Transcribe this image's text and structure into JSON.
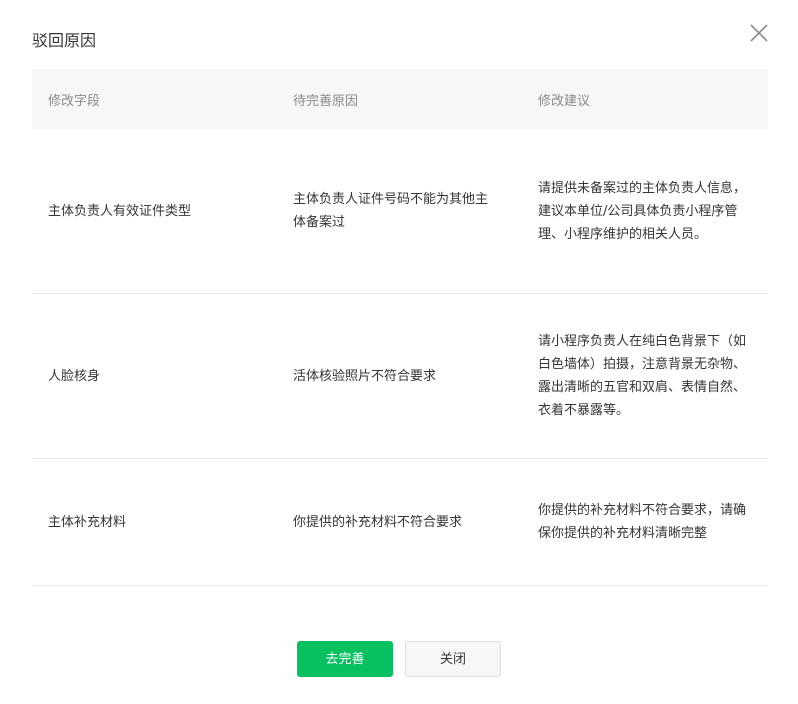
{
  "dialog": {
    "title": "驳回原因",
    "close_icon": "close-icon"
  },
  "table": {
    "headers": [
      "修改字段",
      "待完善原因",
      "修改建议"
    ],
    "rows": [
      {
        "field": "主体负责人有效证件类型",
        "reason": "主体负责人证件号码不能为其他主体备案过",
        "suggestion": "请提供未备案过的主体负责人信息，建议本单位/公司具体负责小程序管理、小程序维护的相关人员。"
      },
      {
        "field": "人脸核身",
        "reason": "活体核验照片不符合要求",
        "suggestion": "请小程序负责人在纯白色背景下（如白色墙体）拍摄，注意背景无杂物、露出清晰的五官和双肩、表情自然、衣着不暴露等。"
      },
      {
        "field": "主体补充材料",
        "reason": "你提供的补充材料不符合要求",
        "suggestion": "你提供的补充材料不符合要求，请确保你提供的补充材料清晰完整"
      }
    ]
  },
  "footer": {
    "primary_label": "去完善",
    "secondary_label": "关闭"
  },
  "colors": {
    "primary": "#07c160",
    "header_bg": "#f6f7f9",
    "border": "#e7e7eb"
  }
}
